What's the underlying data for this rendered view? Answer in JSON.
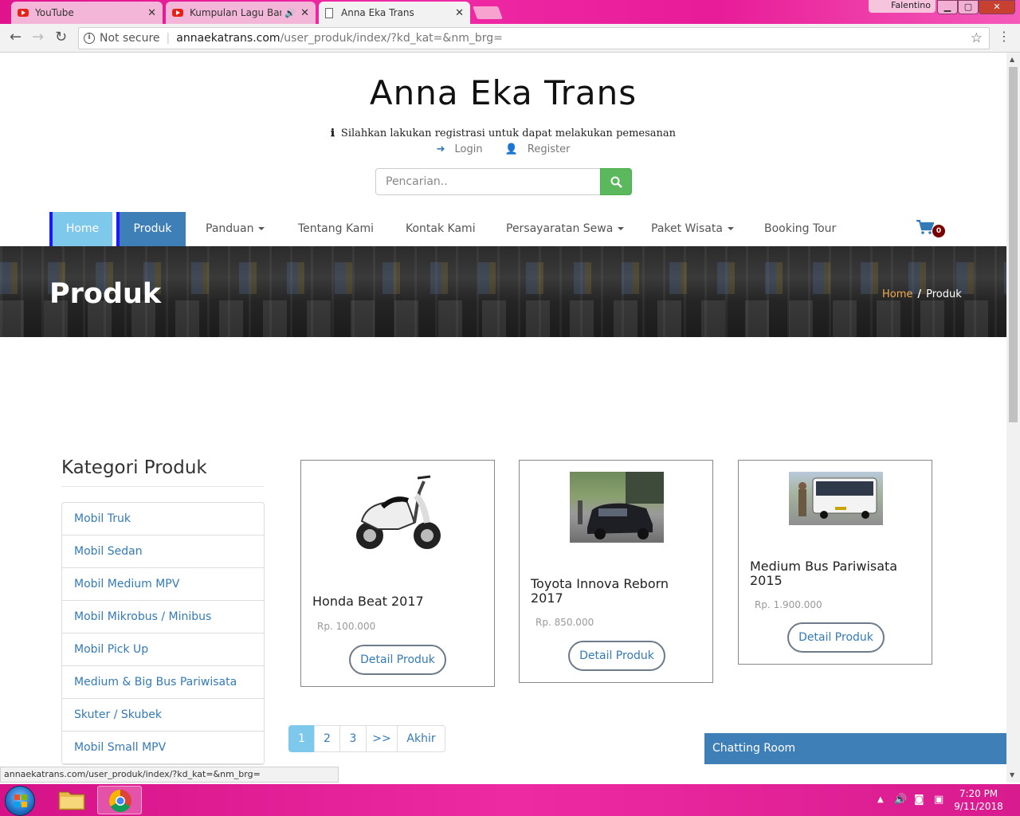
{
  "browser": {
    "tabs": [
      {
        "title": "YouTube",
        "icon": "youtube-icon"
      },
      {
        "title": "Kumpulan Lagu Barat",
        "icon": "youtube-icon"
      },
      {
        "title": "Anna Eka Trans",
        "icon": "document-icon"
      }
    ],
    "user": "Falentino",
    "security": "Not secure",
    "url_domain": "annaekatrans.com",
    "url_path": "/user_produk/index/?kd_kat=&nm_brg="
  },
  "site": {
    "title": "Anna Eka Trans",
    "notice": "Silahkan lakukan registrasi untuk dapat melakukan pemesanan",
    "login": "Login",
    "register": "Register",
    "search_placeholder": "Pencarian.."
  },
  "nav": {
    "home": "Home",
    "produk": "Produk",
    "panduan": "Panduan",
    "tentang": "Tentang Kami",
    "kontak": "Kontak Kami",
    "persyaratan": "Persayaratan Sewa",
    "paket": "Paket Wisata",
    "booking": "Booking Tour",
    "cart_count": "0"
  },
  "banner": {
    "title": "Produk",
    "crumb_home": "Home",
    "crumb_sep": "/",
    "crumb_current": "Produk"
  },
  "sidebar": {
    "title": "Kategori Produk",
    "items": [
      "Mobil Truk",
      "Mobil Sedan",
      "Mobil Medium MPV",
      "Mobil Mikrobus / Minibus",
      "Mobil Pick Up",
      "Medium & Big Bus Pariwisata",
      "Skuter / Skubek",
      "Mobil Small MPV"
    ]
  },
  "products": [
    {
      "name": "Honda Beat 2017",
      "price": "Rp. 100.000",
      "button": "Detail Produk"
    },
    {
      "name": "Toyota Innova Reborn 2017",
      "price": "Rp. 850.000",
      "button": "Detail Produk"
    },
    {
      "name": "Medium Bus Pariwisata 2015",
      "price": "Rp. 1.900.000",
      "button": "Detail Produk"
    }
  ],
  "pagination": [
    "1",
    "2",
    "3",
    ">>",
    "Akhir"
  ],
  "chat": {
    "label": "Chatting Room"
  },
  "status_url": "annaekatrans.com/user_produk/index/?kd_kat=&nm_brg=",
  "clock": {
    "time": "7:20 PM",
    "date": "9/11/2018"
  }
}
